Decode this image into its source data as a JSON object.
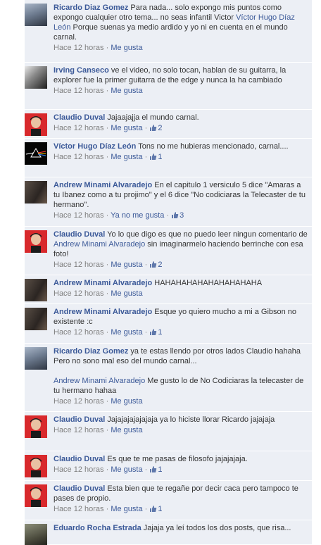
{
  "comments": [
    {
      "author": "Ricardo Diaz Gomez",
      "text": "Para nada... solo expongo mis puntos como expongo cualquier otro tema... no seas infantil Victor",
      "mention": "Víctor Hugo Díaz León",
      "text2": "Porque suenas ya medio ardido y yo ni en cuenta en el mundo carnal.",
      "time": "Hace 12 horas",
      "like": "Me gusta"
    },
    {
      "author": "Irving Canseco",
      "text": "ve el video, no solo tocan, hablan de su guitarra, la explorer fue la primer guitarra de the edge y nunca la ha cambiado",
      "time": "Hace 12 horas",
      "like": "Me gusta"
    },
    {
      "author": "Claudio Duval",
      "text": "Jajaajajja el mundo carnal.",
      "time": "Hace 12 horas",
      "like": "Me gusta",
      "likes": "2"
    },
    {
      "author": "Víctor Hugo Díaz León",
      "text": "Tons no me hubieras mencionado, carnal....",
      "time": "Hace 12 horas",
      "like": "Me gusta",
      "likes": "1"
    },
    {
      "author": "Andrew Minami Alvaradejo",
      "text": "En el capitulo 1 versiculo 5 dice \"Amaras a tu Ibanez como a tu projimo\" y el 6 dice \"No codiciaras la Telecaster de tu hermano\".",
      "time": "Hace 12 horas",
      "like": "Ya no me gusta",
      "likes": "3"
    },
    {
      "author": "Claudio Duval",
      "text": "Yo lo que digo es que no puedo leer ningun comentario de",
      "mention": "Andrew Minami Alvaradejo",
      "text2": "sin imaginarmelo haciendo berrinche con esa foto!",
      "time": "Hace 12 horas",
      "like": "Me gusta",
      "likes": "2"
    },
    {
      "author": "Andrew Minami Alvaradejo",
      "text": "HAHAHAHAHAHAHAHAHAHA",
      "time": "Hace 12 horas",
      "like": "Me gusta"
    },
    {
      "author": "Andrew Minami Alvaradejo",
      "text": "Esque yo quiero mucho a mi a Gibson no existente :c",
      "time": "Hace 12 horas",
      "like": "Me gusta",
      "likes": "1"
    },
    {
      "author": "Ricardo Diaz Gomez",
      "text": "ya te estas llendo por otros lados Claudio hahaha Pero no sono mal eso del mundo carnal...",
      "mention": "Andrew Minami Alvaradejo",
      "text2": "Me gusto lo de No Codiciaras la telecaster de tu hermano hahaa",
      "time": "Hace 12 horas",
      "like": "Me gusta"
    },
    {
      "author": "Claudio Duval",
      "text": "Jajajajajajajaja ya lo hiciste llorar Ricardo jajajaja",
      "time": "Hace 12 horas",
      "like": "Me gusta"
    },
    {
      "author": "Claudio Duval",
      "text": "Es que te me pasas de filosofo jajajajaja.",
      "time": "Hace 12 horas",
      "like": "Me gusta",
      "likes": "1"
    },
    {
      "author": "Claudio Duval",
      "text": "Esta bien que te regañe por decir caca pero tampoco te pases de propio.",
      "time": "Hace 12 horas",
      "like": "Me gusta",
      "likes": "1"
    },
    {
      "author": "Eduardo Rocha Estrada",
      "text": "Jajaja ya leí todos los dos posts, que risa..."
    }
  ]
}
